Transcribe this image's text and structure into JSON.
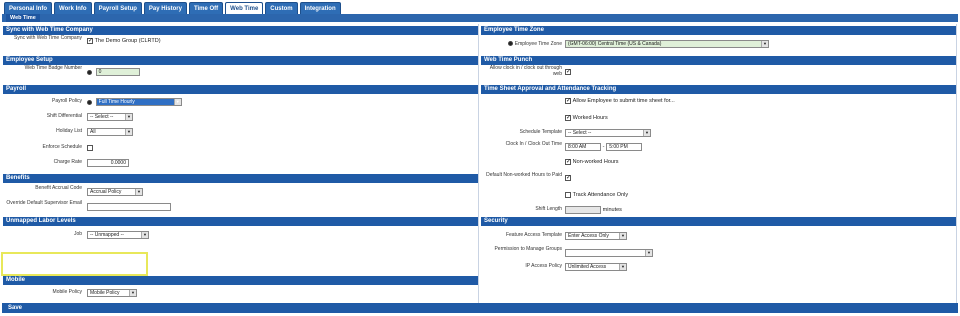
{
  "tabs": [
    "Personal Info",
    "Work Info",
    "Payroll Setup",
    "Pay History",
    "Time Off",
    "Web Time",
    "Custom",
    "Integration"
  ],
  "active_tab": 5,
  "subtab": "Web Time",
  "sync": {
    "title": "Sync with Web Time Company",
    "label": "Sync with Web Time Company",
    "value": "The Demo Group (CLRTD)"
  },
  "employee_setup": {
    "title": "Employee Setup",
    "badge_label": "Web Time Badge Number",
    "badge_value": "0"
  },
  "payroll": {
    "title": "Payroll",
    "policy_label": "Payroll Policy",
    "policy_value": "Full Time Hourly",
    "shift_label": "Shift Differential",
    "shift_value": "-- Select --",
    "holiday_label": "Holiday List",
    "holiday_value": "All",
    "enforce_label": "Enforce Schedule",
    "charge_label": "Charge Rate",
    "charge_value": "0.0000"
  },
  "benefits": {
    "title": "Benefits",
    "benefit_label": "Benefit Accrual Code",
    "benefit_value": "Accrual Policy",
    "supervisor_label": "Override Default Supervisor Email",
    "supervisor_value": ""
  },
  "labor": {
    "title": "Unmapped Labor Levels",
    "job_label": "Job",
    "job_value": "-- Unmapped --"
  },
  "mobile": {
    "title": "Mobile",
    "policy_label": "Mobile Policy",
    "policy_value": "Mobile Policy"
  },
  "time_zone": {
    "title": "Employee Time Zone",
    "label": "Employee Time Zone",
    "value": "(GMT-06:00) Central Time (US & Canada)"
  },
  "punch": {
    "title": "Web Time Punch",
    "label": "Allow clock in / clock out through web"
  },
  "approval": {
    "title": "Time Sheet Approval and Attendance Tracking",
    "allow_submit": "Allow Employee to submit time sheet for...",
    "worked_hours": "Worked Hours",
    "schedule_label": "Schedule Template",
    "schedule_value": "-- Select --",
    "clock_label": "Clock In / Clock Out Time",
    "clock_in": "8:00 AM",
    "clock_sep": "-",
    "clock_out": "5:00 PM",
    "non_worked": "Non-worked Hours",
    "default_label": "Default Non-worked Hours to Paid",
    "track_attendance": "Track Attendance Only",
    "shift_length_label": "Shift Length",
    "shift_length_value": "",
    "shift_length_unit": "minutes"
  },
  "security": {
    "title": "Security",
    "feature_label": "Feature Access Template",
    "feature_value": "Enter Access Only",
    "permission_label": "Permission to Manage Groups",
    "permission_value": "",
    "ip_label": "IP Access Policy",
    "ip_value": "Unlimited Access"
  },
  "footer": {
    "label": "Save"
  }
}
